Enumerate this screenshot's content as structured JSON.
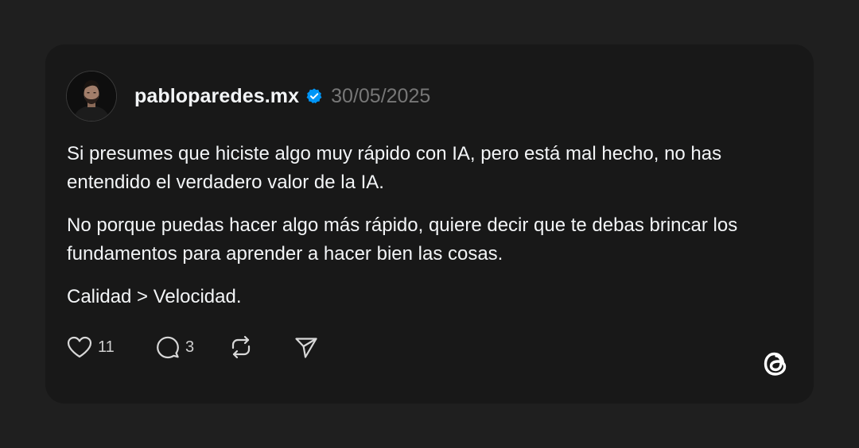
{
  "post": {
    "username": "pabloparedes.mx",
    "date": "30/05/2025",
    "paragraphs": [
      "Si presumes que hiciste algo muy rápido con IA, pero está mal hecho, no has entendido el verdadero valor de la IA.",
      "No porque puedas hacer algo más rápido, quiere decir que te debas brincar los fundamentos para aprender a hacer bien las cosas.",
      "Calidad > Velocidad."
    ],
    "likes": "11",
    "replies": "3"
  },
  "icons": {
    "avatar": "profile-photo",
    "verified": "verified-badge-icon",
    "like": "heart-icon",
    "reply": "comment-bubble-icon",
    "repost": "repost-icon",
    "share": "send-icon",
    "brand": "threads-logo"
  },
  "colors": {
    "background": "#1f1f1f",
    "card": "#181818",
    "text": "#f3f5f7",
    "muted": "#777777",
    "verified": "#0095f6"
  }
}
